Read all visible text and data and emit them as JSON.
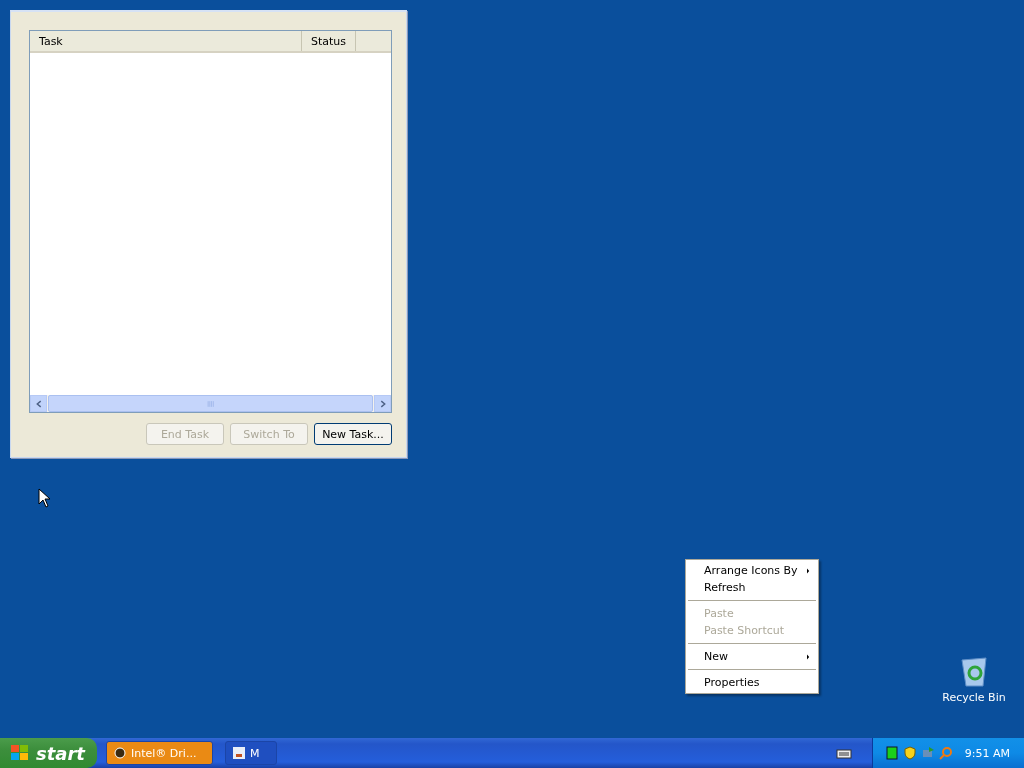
{
  "window": {
    "columns": [
      {
        "label": "Task"
      },
      {
        "label": "Status"
      }
    ],
    "buttons": [
      {
        "label": "End Task",
        "disabled": true
      },
      {
        "label": "Switch To",
        "disabled": true
      },
      {
        "label": "New Task...",
        "disabled": false
      }
    ]
  },
  "context_menu": {
    "items": [
      {
        "kind": "item",
        "label": "Arrange Icons By",
        "disabled": false,
        "submenu": true
      },
      {
        "kind": "item",
        "label": "Refresh",
        "disabled": false,
        "submenu": false
      },
      {
        "kind": "separator"
      },
      {
        "kind": "item",
        "label": "Paste",
        "disabled": true,
        "submenu": false
      },
      {
        "kind": "item",
        "label": "Paste Shortcut",
        "disabled": true,
        "submenu": false
      },
      {
        "kind": "separator"
      },
      {
        "kind": "item",
        "label": "New",
        "disabled": false,
        "submenu": true
      },
      {
        "kind": "separator"
      },
      {
        "kind": "item",
        "label": "Properties",
        "disabled": false,
        "submenu": false
      }
    ]
  },
  "desktop_icons": [
    {
      "label": "Recycle Bin"
    }
  ],
  "taskbar": {
    "start": "start",
    "tasks": [
      {
        "label": "Intel® Dri...",
        "flashing": true
      },
      {
        "label": "M",
        "flashing": false
      }
    ],
    "clock": "9:51 AM"
  }
}
